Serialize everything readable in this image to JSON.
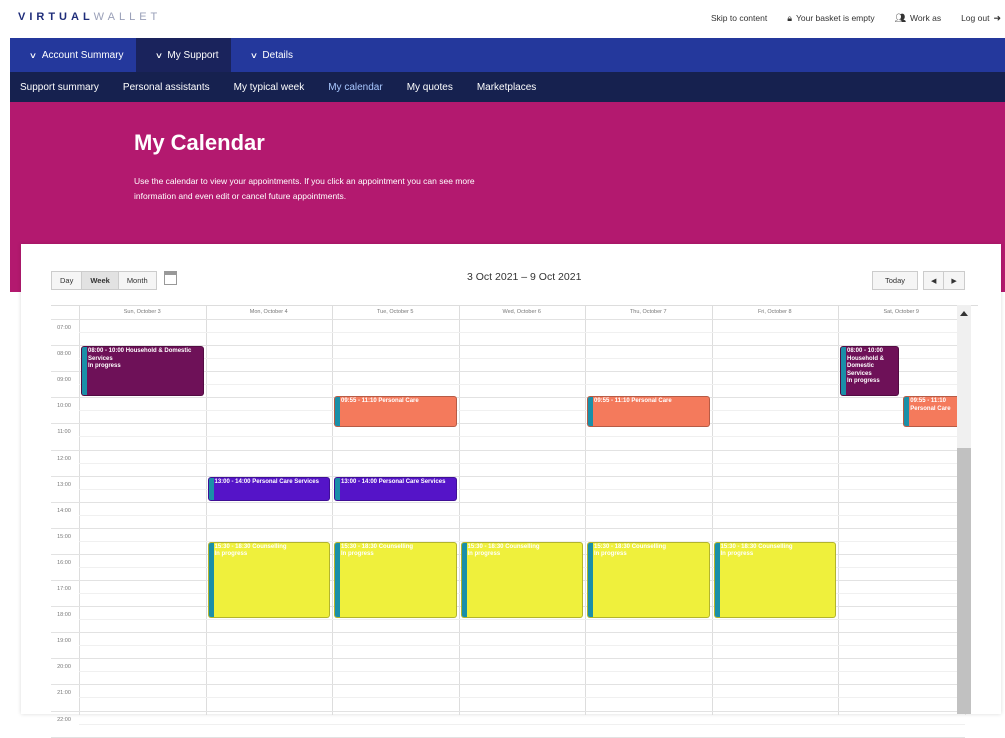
{
  "brand": {
    "part1": "VIRTUAL",
    "part2": "WALLET"
  },
  "toplinks": {
    "skip": "Skip to content",
    "basket": "Your basket is empty",
    "work_as": "Work as",
    "logout": "Log out"
  },
  "nav_main": [
    {
      "label": "Account Summary"
    },
    {
      "label": "My Support"
    },
    {
      "label": "Details"
    }
  ],
  "nav_sub": [
    {
      "label": "Support summary"
    },
    {
      "label": "Personal assistants"
    },
    {
      "label": "My typical week"
    },
    {
      "label": "My calendar"
    },
    {
      "label": "My quotes"
    },
    {
      "label": "Marketplaces"
    }
  ],
  "hero": {
    "title": "My Calendar",
    "intro": "Use the calendar to view your appointments. If you click an appointment you can see more information and even edit or cancel future appointments."
  },
  "calendar": {
    "views": {
      "day": "Day",
      "week": "Week",
      "month": "Month"
    },
    "range": "3 Oct 2021 – 9 Oct 2021",
    "today_label": "Today",
    "prev_label": "◀",
    "next_label": "▶",
    "days": [
      "Sun, October 3",
      "Mon, October 4",
      "Tue, October 5",
      "Wed, October 6",
      "Thu, October 7",
      "Fri, October 8",
      "Sat, October 9"
    ],
    "times": [
      "07:00",
      "08:00",
      "09:00",
      "10:00",
      "11:00",
      "12:00",
      "13:00",
      "14:00",
      "15:00",
      "16:00",
      "17:00",
      "18:00",
      "19:00",
      "20:00",
      "21:00",
      "22:00"
    ],
    "events": [
      {
        "day": 0,
        "title": "08:00 - 10:00 Household & Domestic Services",
        "status": "In progress",
        "color": "#6e1158"
      },
      {
        "day": 6,
        "title": "08:00 - 10:00 Household & Domestic Services",
        "status": "In progress",
        "color": "#6e1158"
      },
      {
        "day": 2,
        "title": "09:55 - 11:10 Personal Care",
        "status": "",
        "color": "#f47a5c"
      },
      {
        "day": 4,
        "title": "09:55 - 11:10 Personal Care",
        "status": "",
        "color": "#f47a5c"
      },
      {
        "day": 6,
        "title": "09:55 - 11:10 Personal Care",
        "status": "",
        "color": "#f47a5c"
      },
      {
        "day": 1,
        "title": "13:00 - 14:00 Personal Care Services",
        "status": "",
        "color": "#5514c8"
      },
      {
        "day": 2,
        "title": "13:00 - 14:00 Personal Care Services",
        "status": "",
        "color": "#5514c8"
      },
      {
        "day": 1,
        "title": "15:30 - 18:30 Counselling",
        "status": "In progress",
        "color": "#eff03c"
      },
      {
        "day": 2,
        "title": "15:30 - 18:30 Counselling",
        "status": "In progress",
        "color": "#eff03c"
      },
      {
        "day": 3,
        "title": "15:30 - 18:30 Counselling",
        "status": "In progress",
        "color": "#eff03c"
      },
      {
        "day": 4,
        "title": "15:30 - 18:30 Counselling",
        "status": "In progress",
        "color": "#eff03c"
      },
      {
        "day": 5,
        "title": "15:30 - 18:30 Counselling",
        "status": "In progress",
        "color": "#eff03c"
      }
    ]
  },
  "colors": {
    "nav_primary": "#24389c",
    "nav_active": "#1a235c",
    "nav_secondary": "#16214f",
    "hero": "#b3196f",
    "event_stripe": "#1a8fa8"
  }
}
